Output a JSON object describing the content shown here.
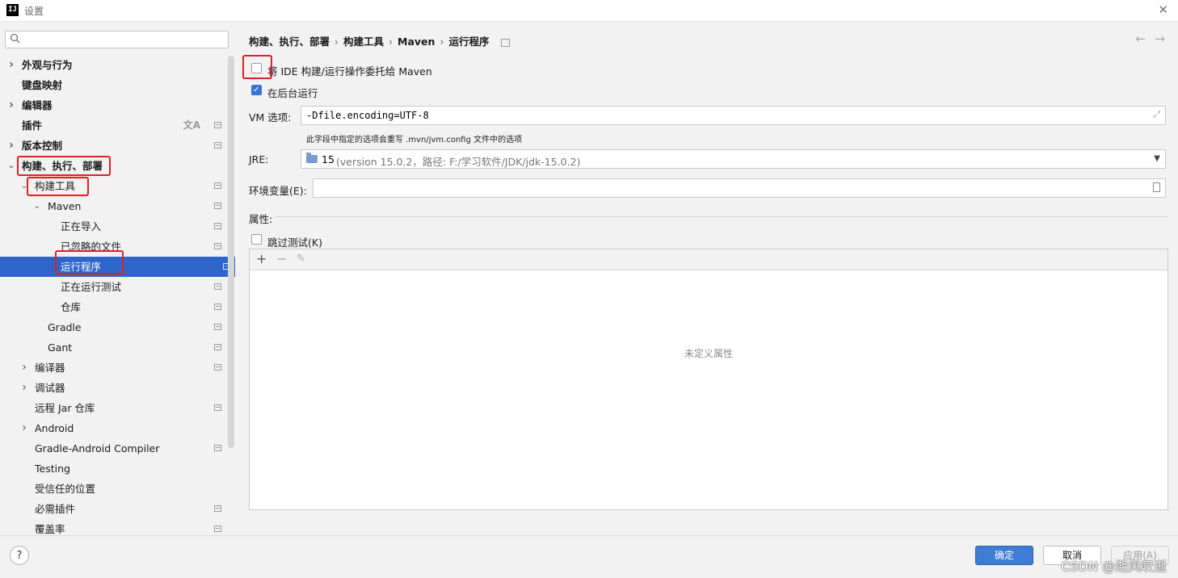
{
  "window": {
    "title": "设置",
    "app_icon_label": "IJ"
  },
  "sidebar": {
    "search_placeholder": "",
    "items": [
      {
        "label": "外观与行为",
        "bold": true,
        "level": 0,
        "arrow": "right",
        "badge": false
      },
      {
        "label": "键盘映射",
        "bold": true,
        "level": 0,
        "arrow": "",
        "badge": false
      },
      {
        "label": "编辑器",
        "bold": true,
        "level": 0,
        "arrow": "right",
        "badge": false
      },
      {
        "label": "插件",
        "bold": true,
        "level": 0,
        "arrow": "",
        "badge": true,
        "lang_icon": true
      },
      {
        "label": "版本控制",
        "bold": true,
        "level": 0,
        "arrow": "right",
        "badge": true
      },
      {
        "label": "构建、执行、部署",
        "bold": true,
        "level": 0,
        "arrow": "down",
        "badge": false
      },
      {
        "label": "构建工具",
        "bold": false,
        "level": 1,
        "arrow": "down",
        "badge": true
      },
      {
        "label": "Maven",
        "bold": false,
        "level": 2,
        "arrow": "down",
        "badge": true
      },
      {
        "label": "正在导入",
        "bold": false,
        "level": 3,
        "arrow": "",
        "badge": true
      },
      {
        "label": "已忽略的文件",
        "bold": false,
        "level": 3,
        "arrow": "",
        "badge": true
      },
      {
        "label": "运行程序",
        "bold": false,
        "level": 3,
        "arrow": "",
        "badge": true,
        "selected": true
      },
      {
        "label": "正在运行测试",
        "bold": false,
        "level": 3,
        "arrow": "",
        "badge": true
      },
      {
        "label": "仓库",
        "bold": false,
        "level": 3,
        "arrow": "",
        "badge": true
      },
      {
        "label": "Gradle",
        "bold": false,
        "level": 2,
        "arrow": "",
        "badge": true
      },
      {
        "label": "Gant",
        "bold": false,
        "level": 2,
        "arrow": "",
        "badge": true
      },
      {
        "label": "编译器",
        "bold": false,
        "level": 1,
        "arrow": "right",
        "badge": true
      },
      {
        "label": "调试器",
        "bold": false,
        "level": 1,
        "arrow": "right",
        "badge": false
      },
      {
        "label": "远程 Jar 仓库",
        "bold": false,
        "level": 1,
        "arrow": "",
        "badge": true
      },
      {
        "label": "Android",
        "bold": false,
        "level": 1,
        "arrow": "right",
        "badge": false
      },
      {
        "label": "Gradle-Android Compiler",
        "bold": false,
        "level": 1,
        "arrow": "",
        "badge": true
      },
      {
        "label": "Testing",
        "bold": false,
        "level": 1,
        "arrow": "",
        "badge": false
      },
      {
        "label": "受信任的位置",
        "bold": false,
        "level": 1,
        "arrow": "",
        "badge": false
      },
      {
        "label": "必需插件",
        "bold": false,
        "level": 1,
        "arrow": "",
        "badge": true
      },
      {
        "label": "覆盖率",
        "bold": false,
        "level": 1,
        "arrow": "",
        "badge": true
      }
    ]
  },
  "breadcrumb": [
    "构建、执行、部署",
    "构建工具",
    "Maven",
    "运行程序"
  ],
  "form": {
    "delegate_label": "将 IDE 构建/运行操作委托给 Maven",
    "delegate_checked": false,
    "background_label": "在后台运行",
    "background_checked": true,
    "vm_label": "VM 选项:",
    "vm_value": "-Dfile.encoding=UTF-8",
    "vm_hint": "此字段中指定的选项会重写 .mvn/jvm.config 文件中的选项",
    "jre_label": "JRE:",
    "jre_version": "15",
    "jre_detail": "(version 15.0.2，路径: F:/学习软件/JDK/jdk-15.0.2)",
    "env_label": "环境变量(E):",
    "env_value": "",
    "properties_label": "属性:",
    "skip_tests_label": "跳过测试(K)",
    "skip_tests_checked": false,
    "empty_properties": "未定义属性"
  },
  "toolbar": {
    "add": "+",
    "remove": "−",
    "edit": "✎"
  },
  "footer": {
    "help": "?",
    "ok": "确定",
    "cancel": "取消",
    "apply": "应用(A)"
  },
  "watermark": "CSDN @滟风叹逝",
  "colors": {
    "accent": "#2f65ca",
    "highlight": "#e02020",
    "ok_button": "#3f7cd3"
  }
}
